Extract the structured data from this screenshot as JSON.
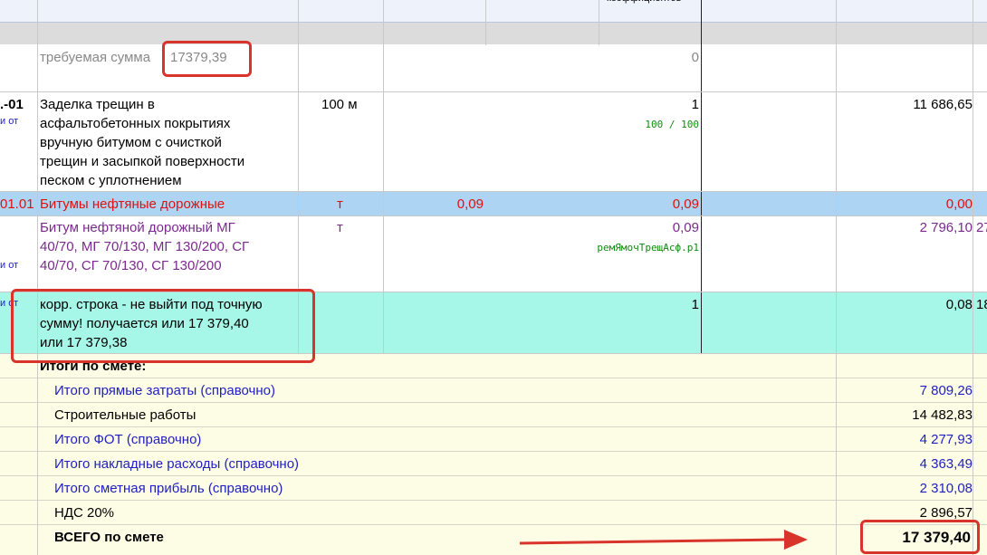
{
  "header": {
    "col_coeff_label": "коэффициентов"
  },
  "required": {
    "label": "требуемая сумма",
    "value": "17379,39",
    "qty": "0"
  },
  "item1": {
    "code": ".-01",
    "sub": "и от",
    "name_lines": [
      "Заделка трещин в",
      "асфальтобетонных покрытиях",
      "вручную битумом с очисткой",
      "трещин и засыпкой поверхности",
      "песком с уплотнением"
    ],
    "unit": "100 м",
    "qty": "1",
    "coef": "100 / 100",
    "amount": "11 686,65"
  },
  "resource": {
    "code": "01.01",
    "name": "Битумы нефтяные дорожные",
    "unit": "т",
    "norm": "0,09",
    "qty": "0,09",
    "amount": "0,00"
  },
  "material": {
    "sub": "и от",
    "name_lines": [
      "Битум нефтяной дорожный МГ",
      "40/70, МГ 70/130, МГ 130/200, СГ",
      "40/70, СГ 70/130, СГ 130/200"
    ],
    "unit": "т",
    "qty": "0,09",
    "coef": "ремЯмочТрещАсф.р1",
    "amount": "2 796,10",
    "amount_cut": "27"
  },
  "corr": {
    "sub": "и от",
    "name_lines": [
      "корр. строка - не выйти под точную",
      "сумму! получается или 17 379,40",
      "или 17 379,38"
    ],
    "qty": "1",
    "amount": "0,08",
    "amount_cut": "18"
  },
  "totals": {
    "header": "Итоги по смете:",
    "rows": [
      {
        "label": "Итого прямые затраты (справочно)",
        "value": "7 809,26",
        "style": "blue"
      },
      {
        "label": "Строительные работы",
        "value": "14 482,83",
        "style": "black"
      },
      {
        "label": "Итого ФОТ (справочно)",
        "value": "4 277,93",
        "style": "blue"
      },
      {
        "label": "Итого накладные расходы (справочно)",
        "value": "4 363,49",
        "style": "blue"
      },
      {
        "label": "Итого сметная прибыль (справочно)",
        "value": "2 310,08",
        "style": "blue"
      },
      {
        "label": "НДС 20%",
        "value": "2 896,57",
        "style": "black"
      }
    ],
    "grand_label": "ВСЕГО по смете",
    "grand_value": "17 379,40"
  },
  "colors": {
    "highlight_red": "#d9342b",
    "resource_row": "#aed4f4",
    "corr_row": "#a6f7e8",
    "totals_row": "#fdfde6",
    "section_bar": "#dcdcdc"
  }
}
